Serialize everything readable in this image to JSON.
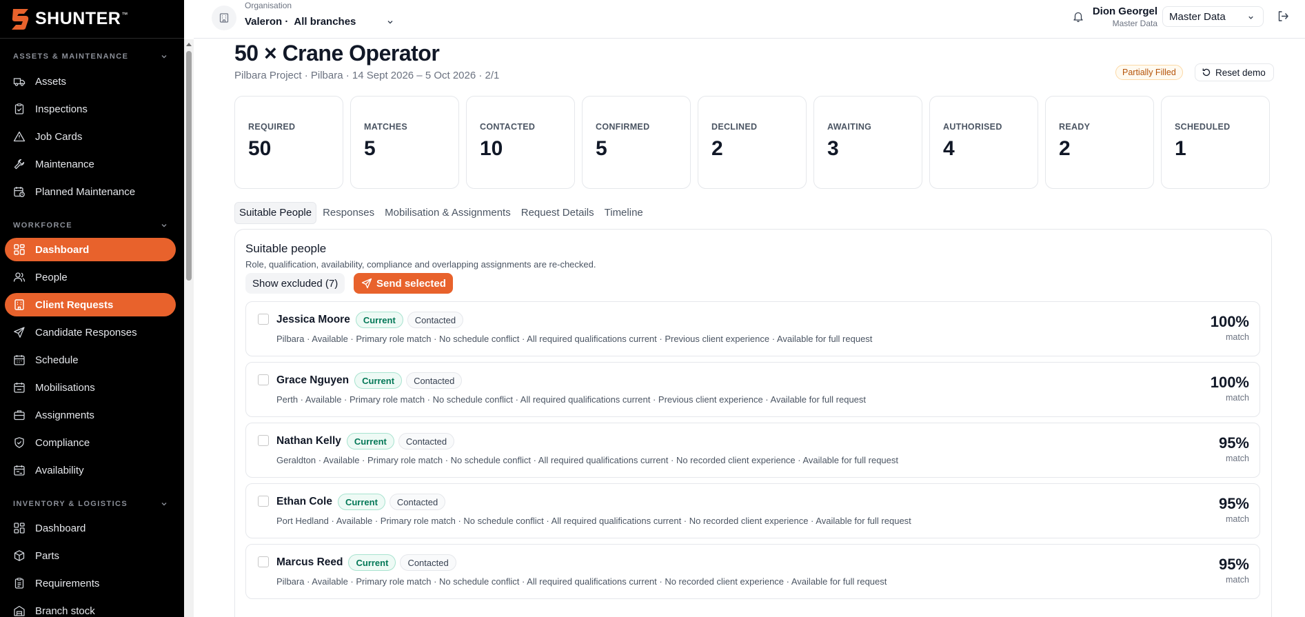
{
  "brand": {
    "name": "SHUNTER",
    "tm": "™",
    "accent": "#e8622c"
  },
  "sidebar": {
    "sections": [
      {
        "title": "ASSETS & MAINTENANCE",
        "items": [
          {
            "label": "Assets",
            "icon": "truck-icon"
          },
          {
            "label": "Inspections",
            "icon": "clipboard-check-icon"
          },
          {
            "label": "Job Cards",
            "icon": "warning-triangle-icon"
          },
          {
            "label": "Maintenance",
            "icon": "wrench-icon"
          },
          {
            "label": "Planned Maintenance",
            "icon": "calendar-clock-icon"
          }
        ]
      },
      {
        "title": "WORKFORCE",
        "items": [
          {
            "label": "Dashboard",
            "icon": "grid-icon",
            "active": true
          },
          {
            "label": "People",
            "icon": "users-icon"
          },
          {
            "label": "Client Requests",
            "icon": "building-icon",
            "active": true
          },
          {
            "label": "Candidate Responses",
            "icon": "send-icon"
          },
          {
            "label": "Schedule",
            "icon": "calendar-icon"
          },
          {
            "label": "Mobilisations",
            "icon": "calendar-check-icon"
          },
          {
            "label": "Assignments",
            "icon": "briefcase-icon"
          },
          {
            "label": "Compliance",
            "icon": "shield-check-icon"
          },
          {
            "label": "Availability",
            "icon": "calendar-range-icon"
          }
        ]
      },
      {
        "title": "INVENTORY & LOGISTICS",
        "items": [
          {
            "label": "Dashboard",
            "icon": "grid-icon"
          },
          {
            "label": "Parts",
            "icon": "package-icon"
          },
          {
            "label": "Requirements",
            "icon": "clipboard-list-icon"
          },
          {
            "label": "Branch stock",
            "icon": "warehouse-icon"
          }
        ]
      }
    ]
  },
  "topbar": {
    "org_label": "Organisation",
    "org_name": "Valeron ·",
    "org_branch": "All branches",
    "user_name": "Dion Georgel",
    "user_role": "Master Data",
    "role_select": "Master Data"
  },
  "page": {
    "title": "50 × Crane Operator",
    "subtitle": "Pilbara Project · Pilbara · 14 Sept 2026 – 5 Oct 2026 · 2/1",
    "status_badge": "Partially Filled",
    "reset_label": "Reset demo"
  },
  "stats": [
    {
      "label": "REQUIRED",
      "value": "50"
    },
    {
      "label": "MATCHES",
      "value": "5"
    },
    {
      "label": "CONTACTED",
      "value": "10"
    },
    {
      "label": "CONFIRMED",
      "value": "5"
    },
    {
      "label": "DECLINED",
      "value": "2"
    },
    {
      "label": "AWAITING",
      "value": "3"
    },
    {
      "label": "AUTHORISED",
      "value": "4"
    },
    {
      "label": "READY",
      "value": "2"
    },
    {
      "label": "SCHEDULED",
      "value": "1"
    }
  ],
  "tabs": [
    {
      "label": "Suitable People",
      "active": true
    },
    {
      "label": "Responses"
    },
    {
      "label": "Mobilisation & Assignments"
    },
    {
      "label": "Request Details"
    },
    {
      "label": "Timeline"
    }
  ],
  "panel": {
    "title": "Suitable people",
    "subtitle": "Role, qualification, availability, compliance and overlapping assignments are re-checked.",
    "show_excluded": "Show excluded (7)",
    "send_selected": "Send selected",
    "match_label": "match"
  },
  "people": [
    {
      "name": "Jessica Moore",
      "status": "Current",
      "contact": "Contacted",
      "details": "Pilbara · Available · Primary role match · No schedule conflict · All required qualifications current · Previous client experience · Available for full request",
      "score": "100%"
    },
    {
      "name": "Grace Nguyen",
      "status": "Current",
      "contact": "Contacted",
      "details": "Perth · Available · Primary role match · No schedule conflict · All required qualifications current · Previous client experience · Available for full request",
      "score": "100%"
    },
    {
      "name": "Nathan Kelly",
      "status": "Current",
      "contact": "Contacted",
      "details": "Geraldton · Available · Primary role match · No schedule conflict · All required qualifications current · No recorded client experience · Available for full request",
      "score": "95%"
    },
    {
      "name": "Ethan Cole",
      "status": "Current",
      "contact": "Contacted",
      "details": "Port Hedland · Available · Primary role match · No schedule conflict · All required qualifications current · No recorded client experience · Available for full request",
      "score": "95%"
    },
    {
      "name": "Marcus Reed",
      "status": "Current",
      "contact": "Contacted",
      "details": "Pilbara · Available · Primary role match · No schedule conflict · All required qualifications current · No recorded client experience · Available for full request",
      "score": "95%"
    }
  ]
}
